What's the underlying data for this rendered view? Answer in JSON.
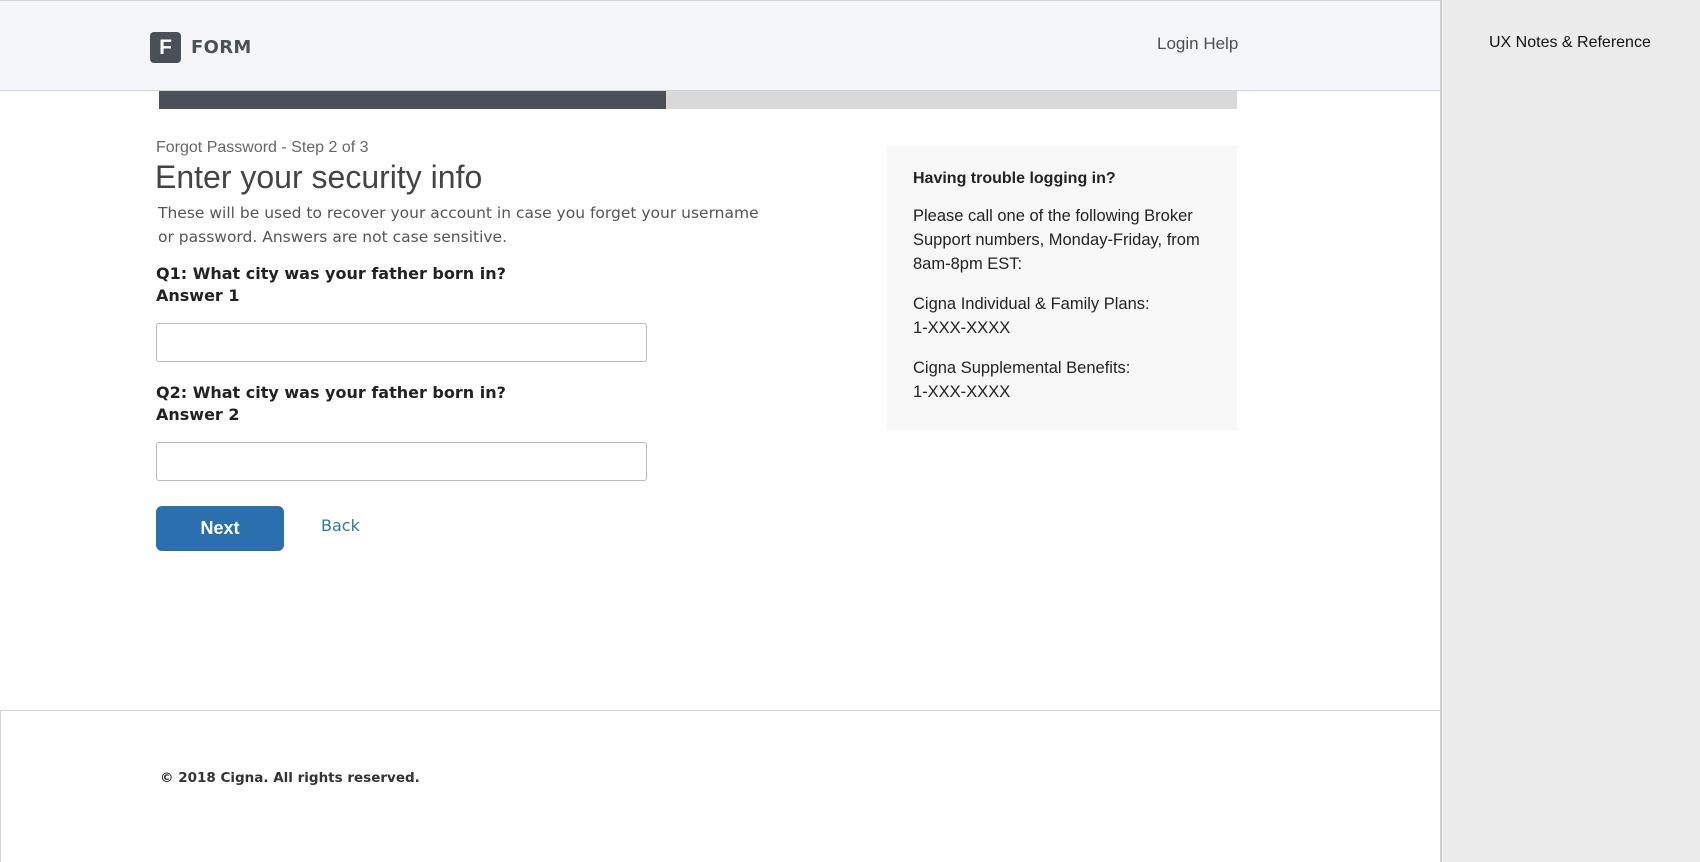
{
  "header": {
    "logo_letter": "F",
    "brand_name": "FORM",
    "login_help": "Login Help"
  },
  "progress": {
    "current_step": 2,
    "total_steps": 3,
    "fraction_complete": 0.47
  },
  "form": {
    "step_label": "Forgot Password - Step 2 of 3",
    "title": "Enter your security info",
    "description": "These will be used to recover your account in case you forget your username or password. Answers are not case sensitive.",
    "q1": {
      "question": "Q1: What city was your father born in?",
      "answer_label": "Answer 1",
      "value": ""
    },
    "q2": {
      "question": "Q2: What city was your father born in?",
      "answer_label": "Answer 2",
      "value": ""
    },
    "next_label": "Next",
    "back_label": "Back"
  },
  "help": {
    "title": "Having trouble logging in?",
    "intro": "Please call one of the following Broker Support numbers, Monday-Friday, from 8am-8pm EST:",
    "lines": [
      {
        "name": "Cigna Individual & Family Plans:",
        "phone": "1-XXX-XXXX"
      },
      {
        "name": "Cigna Supplemental Benefits:",
        "phone": "1-XXX-XXXX"
      }
    ]
  },
  "footer": {
    "copyright": "© 2018 Cigna. All rights reserved."
  },
  "notes_panel": {
    "title": "UX Notes & Reference"
  },
  "colors": {
    "primary_button": "#2b6faf",
    "progress_fill": "#4b4f58",
    "progress_track": "#d9d9d9",
    "link": "#2e7a98"
  }
}
